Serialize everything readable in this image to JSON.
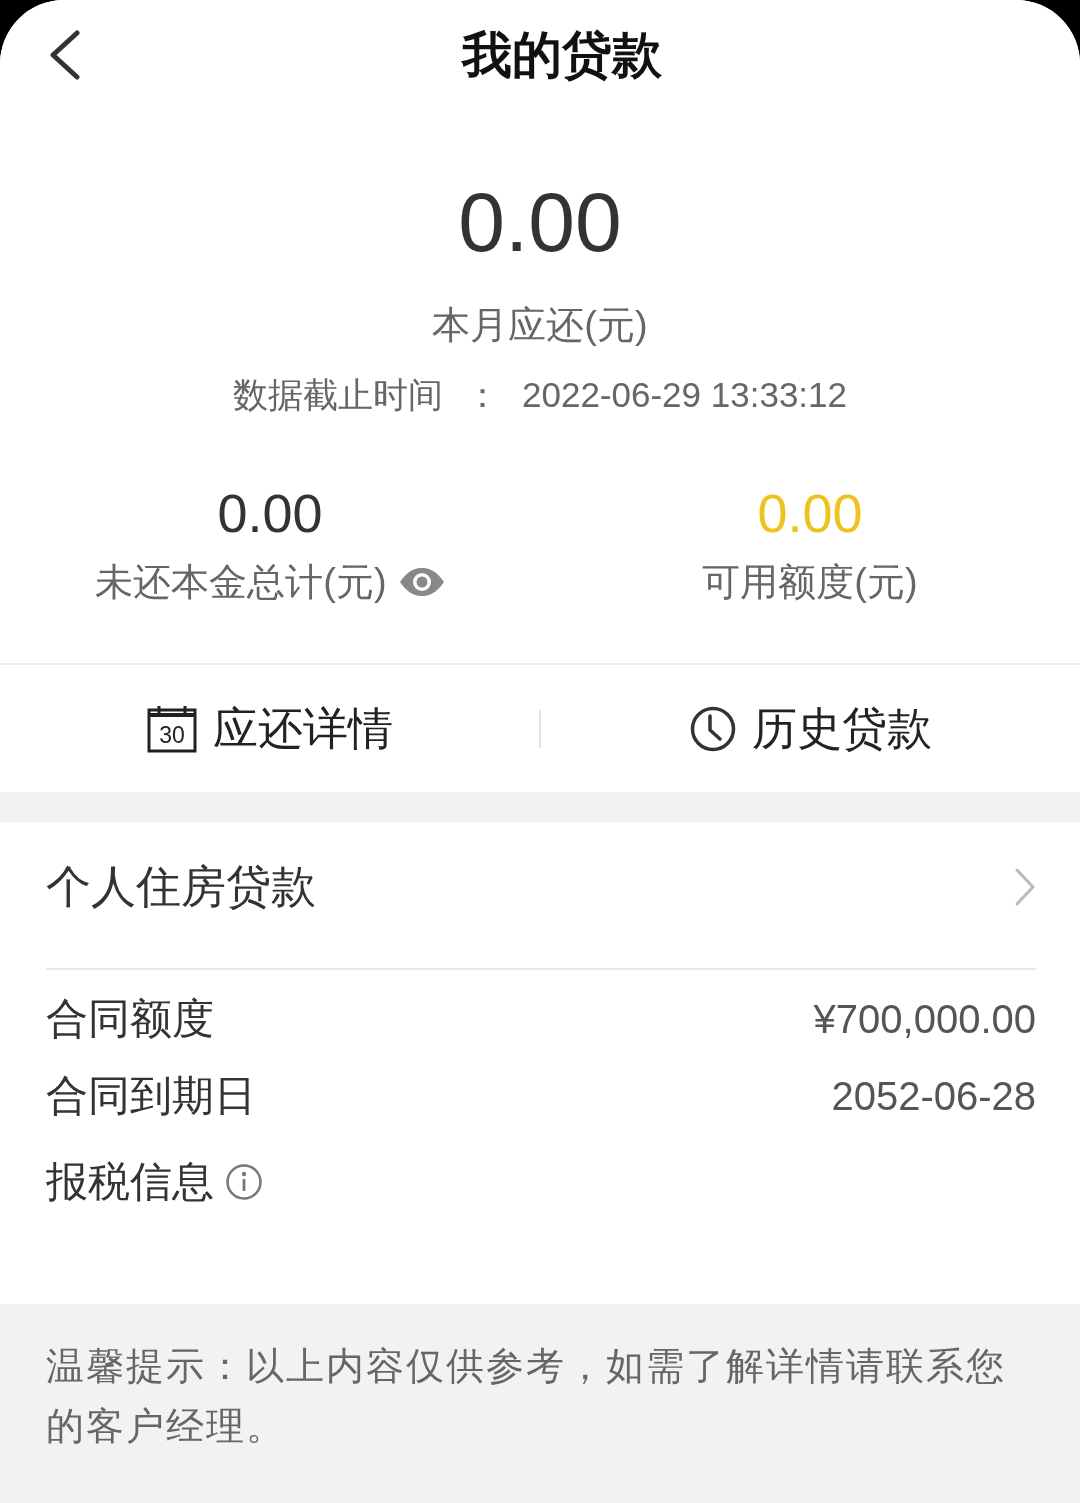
{
  "header": {
    "title": "我的贷款"
  },
  "summary": {
    "amount": "0.00",
    "amount_label": "本月应还(元)",
    "cutoff_label": "数据截止时间",
    "cutoff_separator": "：",
    "cutoff_time": "2022-06-29 13:33:12"
  },
  "stats": [
    {
      "value": "0.00",
      "label": "未还本金总计(元)",
      "kind": "eye",
      "highlighted": false
    },
    {
      "value": "0.00",
      "label": "可用额度(元)",
      "kind": "plain",
      "highlighted": true
    }
  ],
  "actions": [
    {
      "label": "应还详情",
      "kind": "calendar",
      "icon_text": "30"
    },
    {
      "label": "历史贷款",
      "kind": "clock"
    }
  ],
  "loan": {
    "title": "个人住房贷款",
    "fields": [
      {
        "label": "合同额度",
        "value": "¥700,000.00",
        "kind": "value"
      },
      {
        "label": "合同到期日",
        "value": "2052-06-28",
        "kind": "value"
      },
      {
        "label": "报税信息",
        "kind": "info"
      }
    ]
  },
  "notice": {
    "text": "温馨提示：以上内容仅供参考，如需了解详情请联系您的客户经理。"
  }
}
